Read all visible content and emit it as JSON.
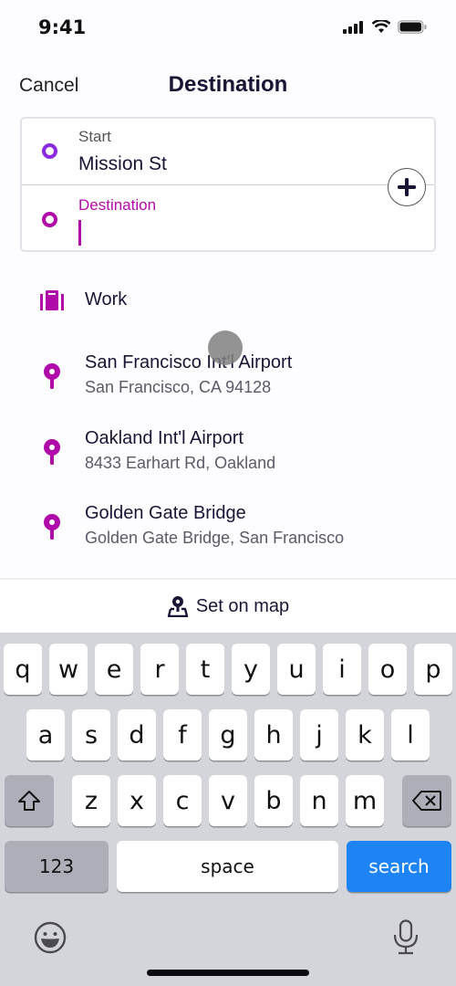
{
  "status_bar": {
    "time": "9:41",
    "icons": [
      "cellular-signal-icon",
      "wifi-icon",
      "battery-icon"
    ]
  },
  "nav": {
    "cancel_label": "Cancel",
    "title": "Destination"
  },
  "route": {
    "start": {
      "label": "Start",
      "value": "Mission St",
      "color": "#8a2be2"
    },
    "destination": {
      "label": "Destination",
      "value": "",
      "color": "#b00aa8"
    },
    "add_stop_icon": "plus-icon"
  },
  "suggestions": [
    {
      "icon": "briefcase-icon",
      "title": "Work",
      "subtitle": ""
    },
    {
      "icon": "map-pin-icon",
      "title": "San Francisco Int'l Airport",
      "subtitle": "San Francisco, CA 94128"
    },
    {
      "icon": "map-pin-icon",
      "title": "Oakland Int'l Airport",
      "subtitle": "8433 Earhart Rd, Oakland"
    },
    {
      "icon": "map-pin-icon",
      "title": "Golden Gate Bridge",
      "subtitle": "Golden Gate Bridge, San Francisco"
    }
  ],
  "set_on_map": {
    "label": "Set on map",
    "icon": "map-marker-icon"
  },
  "keyboard": {
    "row1": [
      "q",
      "w",
      "e",
      "r",
      "t",
      "y",
      "u",
      "i",
      "o",
      "p"
    ],
    "row2": [
      "a",
      "s",
      "d",
      "f",
      "g",
      "h",
      "j",
      "k",
      "l"
    ],
    "row3": [
      "z",
      "x",
      "c",
      "v",
      "b",
      "n",
      "m"
    ],
    "numbers_label": "123",
    "space_label": "space",
    "search_label": "search",
    "accent_color": "#1e83f5"
  },
  "colors": {
    "accent_magenta": "#b00aa8",
    "accent_purple": "#8a2be2",
    "text_dark": "#1a1535"
  }
}
